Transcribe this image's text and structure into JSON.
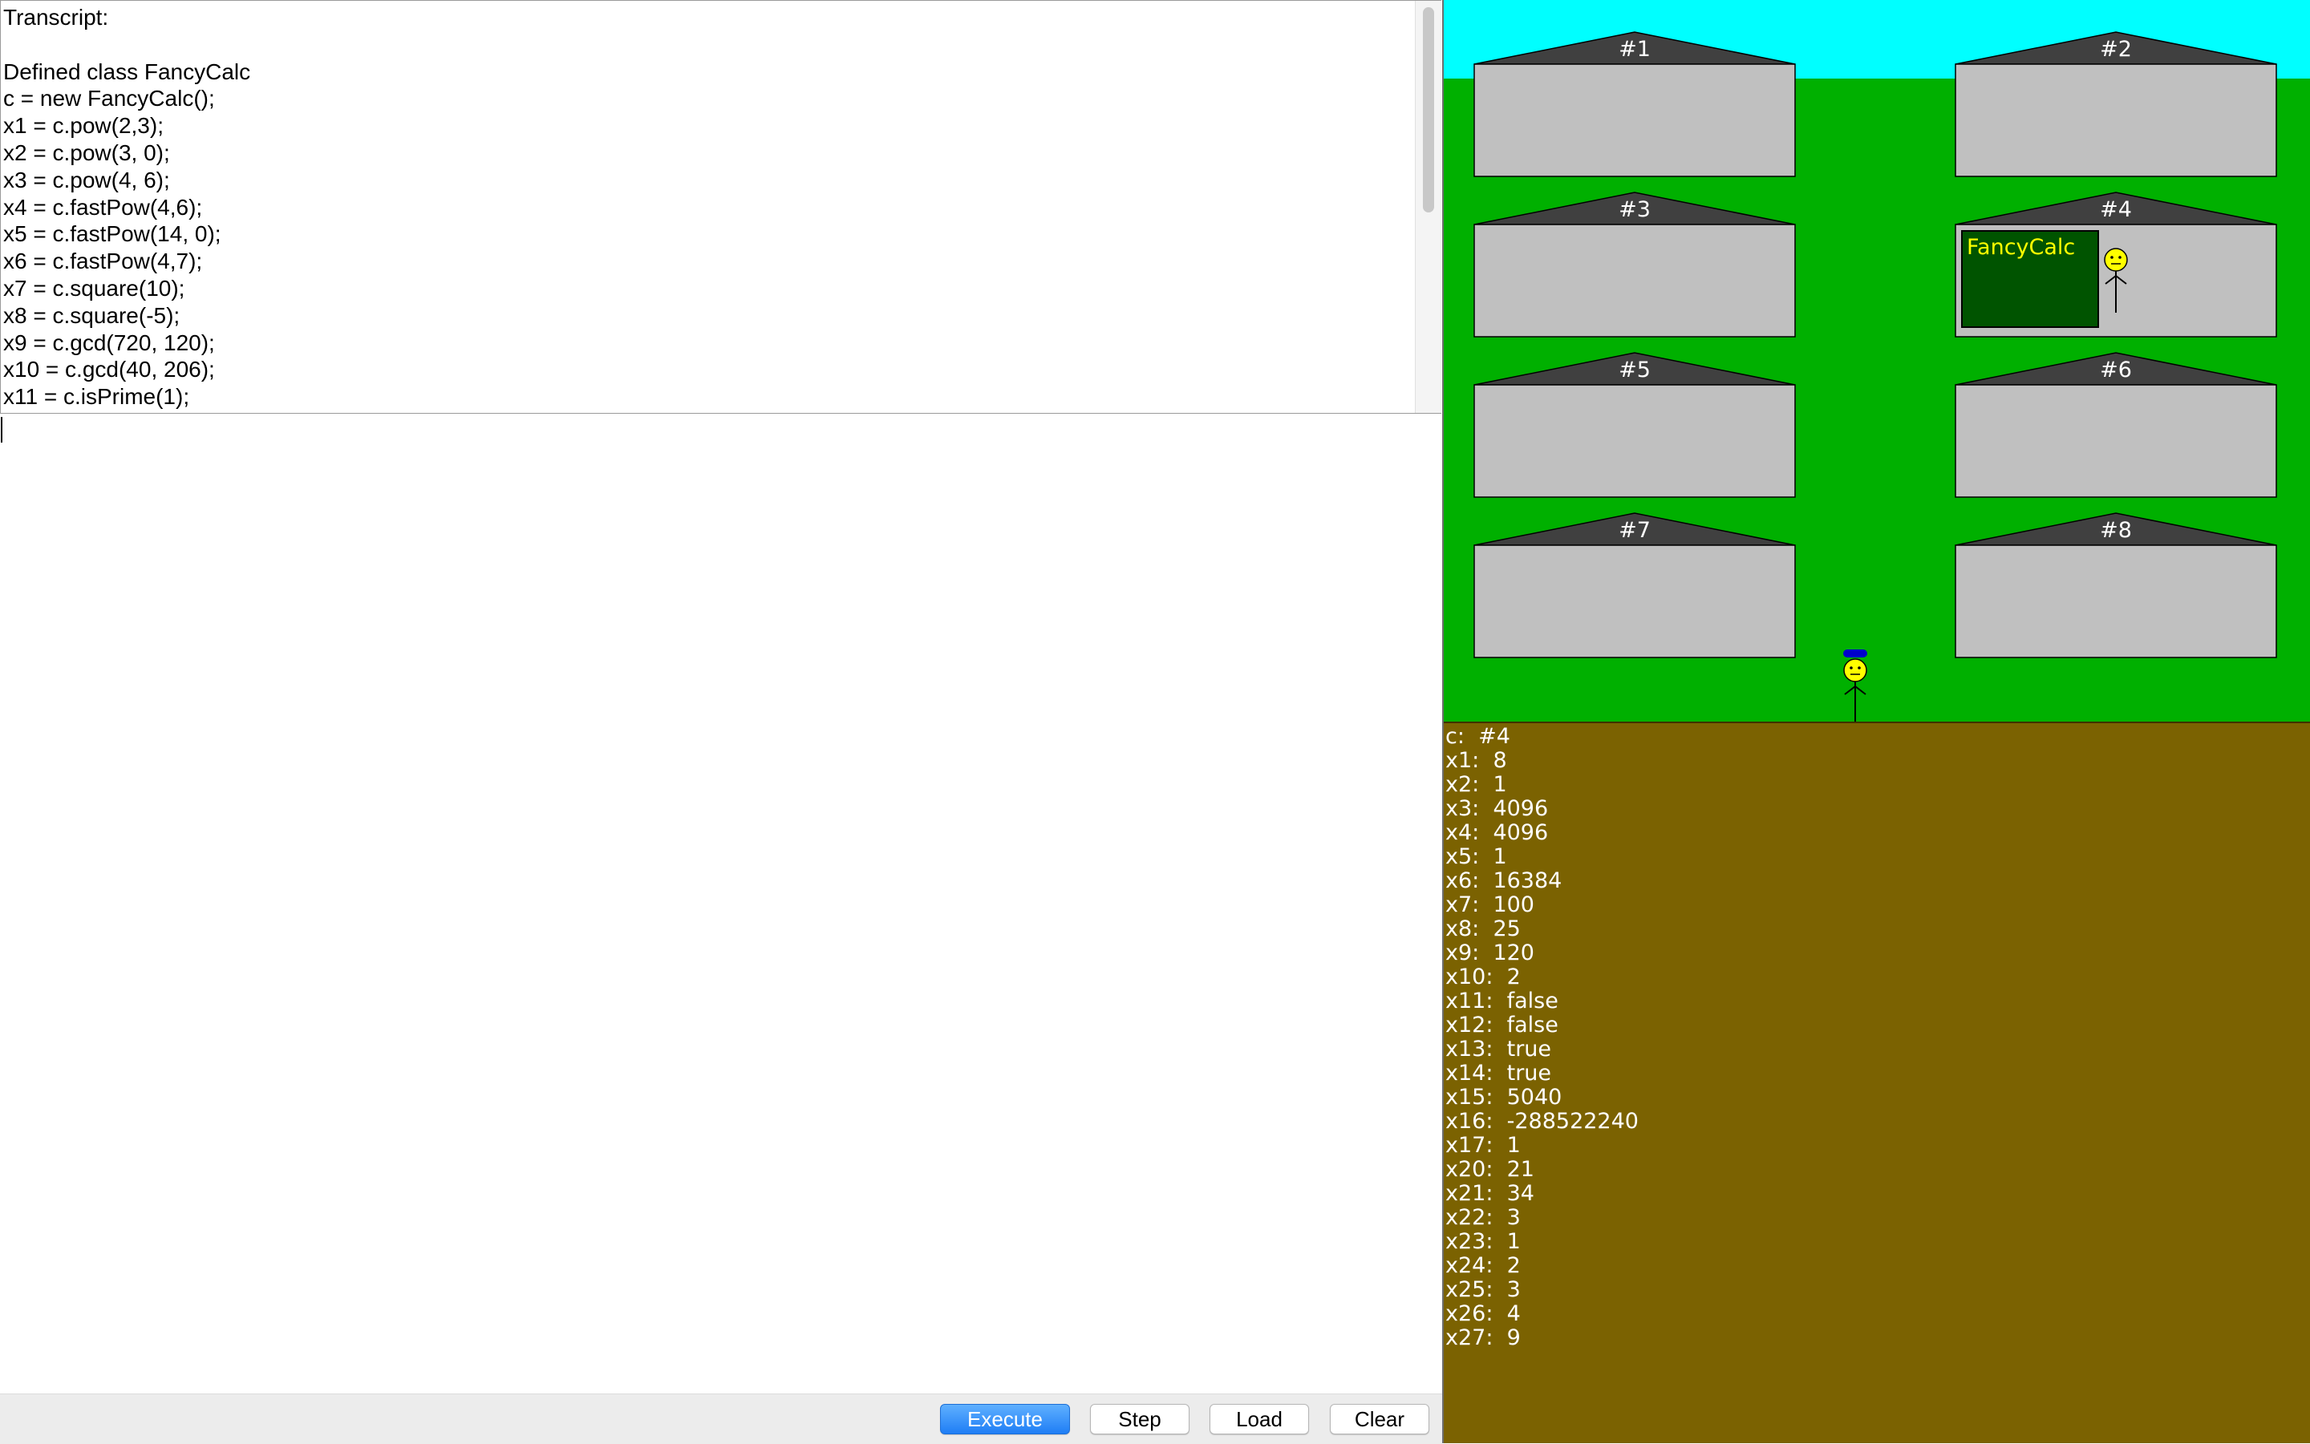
{
  "transcript": {
    "lines": [
      "Transcript:",
      "",
      "Defined class FancyCalc",
      "c = new FancyCalc();",
      "x1 = c.pow(2,3);",
      "x2 = c.pow(3, 0);",
      "x3 = c.pow(4, 6);",
      "x4 = c.fastPow(4,6);",
      "x5 = c.fastPow(14, 0);",
      "x6 = c.fastPow(4,7);",
      "x7 = c.square(10);",
      "x8 = c.square(-5);",
      "x9 = c.gcd(720, 120);",
      "x10 = c.gcd(40, 206);",
      "x11 = c.isPrime(1);"
    ]
  },
  "input": {
    "value": ""
  },
  "buttons": {
    "execute": "Execute",
    "step": "Step",
    "load": "Load",
    "clear": "Clear"
  },
  "world": {
    "houses": [
      {
        "label": "#1",
        "object": ""
      },
      {
        "label": "#2",
        "object": ""
      },
      {
        "label": "#3",
        "object": ""
      },
      {
        "label": "#4",
        "object": "FancyCalc"
      },
      {
        "label": "#5",
        "object": ""
      },
      {
        "label": "#6",
        "object": ""
      },
      {
        "label": "#7",
        "object": ""
      },
      {
        "label": "#8",
        "object": ""
      }
    ],
    "colors": {
      "sky": "#00ffff",
      "grass": "#00b000",
      "house_wall": "#c0c0c0",
      "roof": "#404040",
      "object_box": "#005400",
      "object_text": "#ffff00",
      "figure_face": "#ffff00",
      "hat": "#0000cc"
    }
  },
  "variables": [
    {
      "name": "c",
      "value": "#4"
    },
    {
      "name": "x1",
      "value": "8"
    },
    {
      "name": "x2",
      "value": "1"
    },
    {
      "name": "x3",
      "value": "4096"
    },
    {
      "name": "x4",
      "value": "4096"
    },
    {
      "name": "x5",
      "value": "1"
    },
    {
      "name": "x6",
      "value": "16384"
    },
    {
      "name": "x7",
      "value": "100"
    },
    {
      "name": "x8",
      "value": "25"
    },
    {
      "name": "x9",
      "value": "120"
    },
    {
      "name": "x10",
      "value": "2"
    },
    {
      "name": "x11",
      "value": "false"
    },
    {
      "name": "x12",
      "value": "false"
    },
    {
      "name": "x13",
      "value": "true"
    },
    {
      "name": "x14",
      "value": "true"
    },
    {
      "name": "x15",
      "value": "5040"
    },
    {
      "name": "x16",
      "value": "-288522240"
    },
    {
      "name": "x17",
      "value": "1"
    },
    {
      "name": "x20",
      "value": "21"
    },
    {
      "name": "x21",
      "value": "34"
    },
    {
      "name": "x22",
      "value": "3"
    },
    {
      "name": "x23",
      "value": "1"
    },
    {
      "name": "x24",
      "value": "2"
    },
    {
      "name": "x25",
      "value": "3"
    },
    {
      "name": "x26",
      "value": "4"
    },
    {
      "name": "x27",
      "value": "9"
    }
  ]
}
